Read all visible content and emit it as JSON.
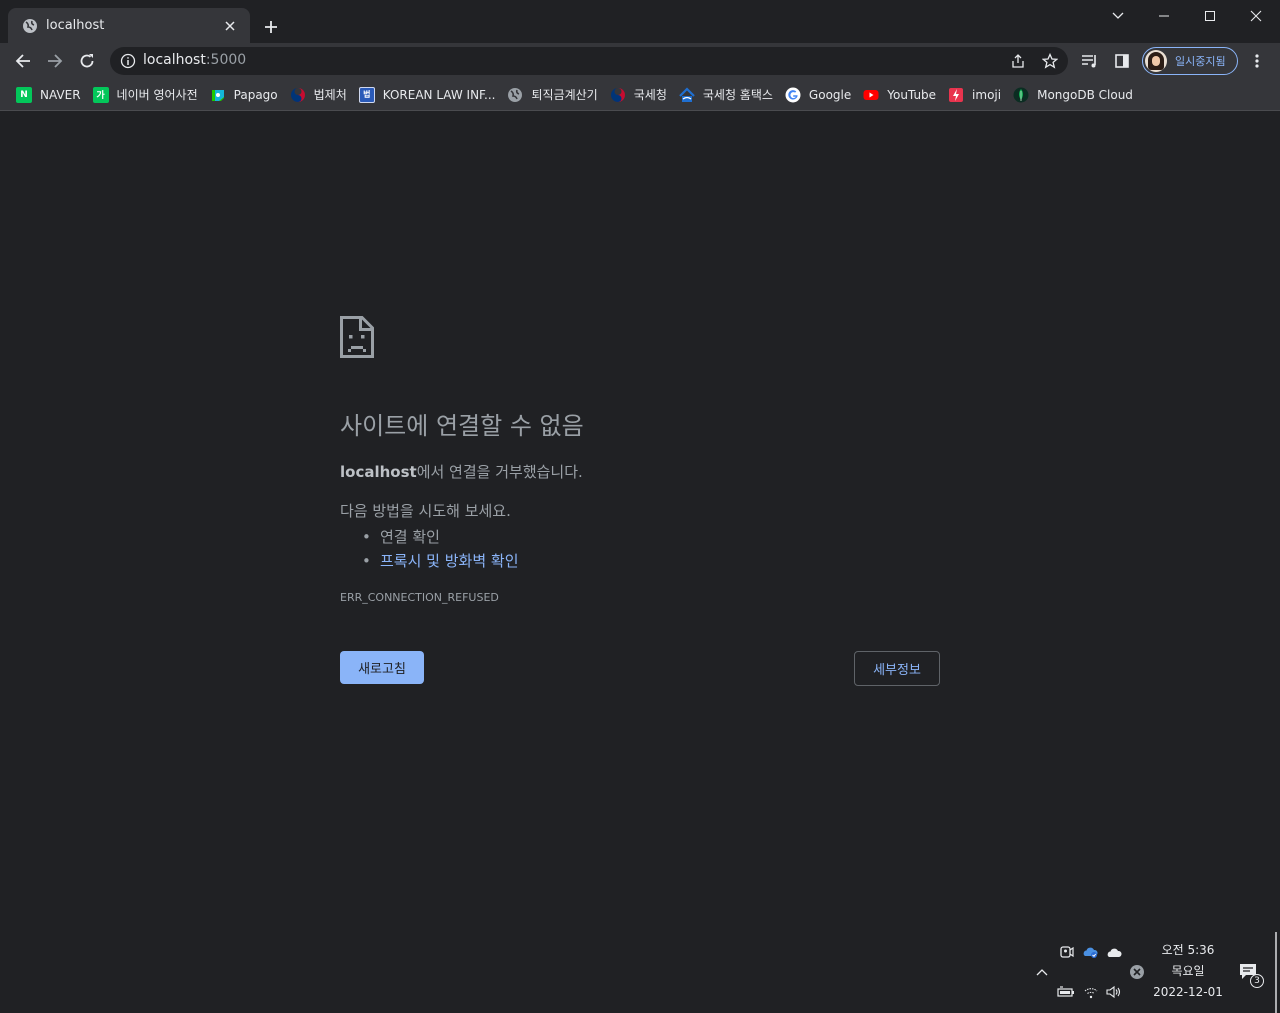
{
  "tab": {
    "title": "localhost",
    "favicon": "globe-icon",
    "close_icon": "close-icon"
  },
  "toolbar": {
    "url_host": "localhost",
    "url_port": ":5000",
    "profile_label": "일시중지됨"
  },
  "bookmarks": [
    {
      "label": "NAVER",
      "icon": "naver-icon",
      "color": "#03c75a",
      "glyph": "N"
    },
    {
      "label": "네이버 영어사전",
      "icon": "naver-dict-icon",
      "color": "#03c75a",
      "glyph": "가"
    },
    {
      "label": "Papago",
      "icon": "papago-icon",
      "color": "#1ec800",
      "glyph": ""
    },
    {
      "label": "법제처",
      "icon": "korea-gov-icon",
      "color": "#c60c30",
      "glyph": ""
    },
    {
      "label": "KOREAN LAW INF...",
      "icon": "law-info-icon",
      "color": "#2a5ab8",
      "glyph": "법"
    },
    {
      "label": "퇴직금계산기",
      "icon": "globe-icon",
      "color": "#9aa0a6",
      "glyph": ""
    },
    {
      "label": "국세청",
      "icon": "korea-gov-icon",
      "color": "#c60c30",
      "glyph": ""
    },
    {
      "label": "국세청 홈택스",
      "icon": "hometax-icon",
      "color": "#1f6fd1",
      "glyph": ""
    },
    {
      "label": "Google",
      "icon": "google-icon",
      "color": "#ffffff",
      "glyph": "G"
    },
    {
      "label": "YouTube",
      "icon": "youtube-icon",
      "color": "#ff0000",
      "glyph": ""
    },
    {
      "label": "imoji",
      "icon": "imoji-icon",
      "color": "#e8344e",
      "glyph": ""
    },
    {
      "label": "MongoDB Cloud",
      "icon": "mongodb-icon",
      "color": "#13aa52",
      "glyph": ""
    }
  ],
  "error": {
    "title": "사이트에 연결할 수 없음",
    "host": "localhost",
    "message": "에서 연결을 거부했습니다.",
    "try_intro": "다음 방법을 시도해 보세요.",
    "suggestions": [
      "연결 확인",
      "프록시 및 방화벽 확인"
    ],
    "code": "ERR_CONNECTION_REFUSED",
    "reload_label": "새로고침",
    "details_label": "세부정보"
  },
  "tray": {
    "time": "오전 5:36",
    "weekday": "목요일",
    "date": "2022-12-01",
    "notification_count": "3"
  }
}
